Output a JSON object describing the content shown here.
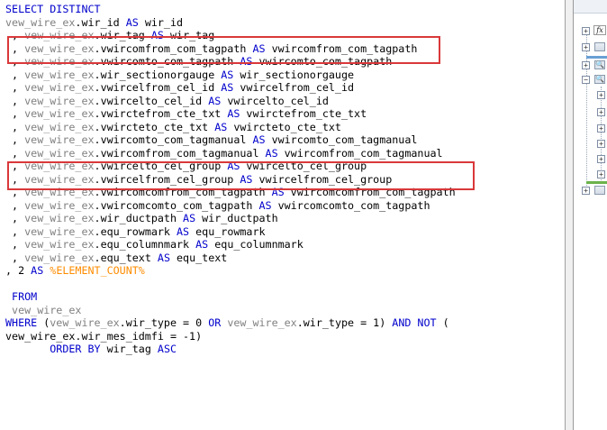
{
  "editor": {
    "highlight_color": "#d9383a",
    "lines": [
      [
        {
          "t": "SELECT DISTINCT",
          "c": "kw"
        }
      ],
      [
        {
          "t": "vew_wire_ex",
          "c": "tbl"
        },
        {
          "t": ".wir_id ",
          "c": "p"
        },
        {
          "t": "AS",
          "c": "kw"
        },
        {
          "t": " wir_id",
          "c": "p"
        }
      ],
      [
        {
          "t": " , ",
          "c": "p"
        },
        {
          "t": "vew_wire_ex",
          "c": "tbl"
        },
        {
          "t": ".wir_tag ",
          "c": "p"
        },
        {
          "t": "AS",
          "c": "kw"
        },
        {
          "t": " wir_tag",
          "c": "p"
        }
      ],
      [
        {
          "t": " , ",
          "c": "p"
        },
        {
          "t": "vew_wire_ex",
          "c": "tbl"
        },
        {
          "t": ".vwircomfrom_com_tagpath ",
          "c": "p"
        },
        {
          "t": "AS",
          "c": "kw"
        },
        {
          "t": " vwircomfrom_com_tagpath",
          "c": "p"
        }
      ],
      [
        {
          "t": " , ",
          "c": "p"
        },
        {
          "t": "vew_wire_ex",
          "c": "tbl"
        },
        {
          "t": ".vwircomto_com_tagpath ",
          "c": "p"
        },
        {
          "t": "AS",
          "c": "kw"
        },
        {
          "t": " vwircomto_com_tagpath",
          "c": "p"
        }
      ],
      [
        {
          "t": " , ",
          "c": "p"
        },
        {
          "t": "vew_wire_ex",
          "c": "tbl"
        },
        {
          "t": ".wir_sectionorgauge ",
          "c": "p"
        },
        {
          "t": "AS",
          "c": "kw"
        },
        {
          "t": " wir_sectionorgauge",
          "c": "p"
        }
      ],
      [
        {
          "t": " , ",
          "c": "p"
        },
        {
          "t": "vew_wire_ex",
          "c": "tbl"
        },
        {
          "t": ".vwircelfrom_cel_id ",
          "c": "p"
        },
        {
          "t": "AS",
          "c": "kw"
        },
        {
          "t": " vwircelfrom_cel_id",
          "c": "p"
        }
      ],
      [
        {
          "t": " , ",
          "c": "p"
        },
        {
          "t": "vew_wire_ex",
          "c": "tbl"
        },
        {
          "t": ".vwircelto_cel_id ",
          "c": "p"
        },
        {
          "t": "AS",
          "c": "kw"
        },
        {
          "t": " vwircelto_cel_id",
          "c": "p"
        }
      ],
      [
        {
          "t": " , ",
          "c": "p"
        },
        {
          "t": "vew_wire_ex",
          "c": "tbl"
        },
        {
          "t": ".vwirctefrom_cte_txt ",
          "c": "p"
        },
        {
          "t": "AS",
          "c": "kw"
        },
        {
          "t": " vwirctefrom_cte_txt",
          "c": "p"
        }
      ],
      [
        {
          "t": " , ",
          "c": "p"
        },
        {
          "t": "vew_wire_ex",
          "c": "tbl"
        },
        {
          "t": ".vwircteto_cte_txt ",
          "c": "p"
        },
        {
          "t": "AS",
          "c": "kw"
        },
        {
          "t": " vwircteto_cte_txt",
          "c": "p"
        }
      ],
      [
        {
          "t": " , ",
          "c": "p"
        },
        {
          "t": "vew_wire_ex",
          "c": "tbl"
        },
        {
          "t": ".vwircomto_com_tagmanual ",
          "c": "p"
        },
        {
          "t": "AS",
          "c": "kw"
        },
        {
          "t": " vwircomto_com_tagmanual",
          "c": "p"
        }
      ],
      [
        {
          "t": " , ",
          "c": "p"
        },
        {
          "t": "vew_wire_ex",
          "c": "tbl"
        },
        {
          "t": ".vwircomfrom_com_tagmanual ",
          "c": "p"
        },
        {
          "t": "AS",
          "c": "kw"
        },
        {
          "t": " vwircomfrom_com_tagmanual",
          "c": "p"
        }
      ],
      [
        {
          "t": " , ",
          "c": "p"
        },
        {
          "t": "vew_wire_ex",
          "c": "tbl"
        },
        {
          "t": ".vwircelto_cel_group ",
          "c": "p"
        },
        {
          "t": "AS",
          "c": "kw"
        },
        {
          "t": " vwircelto_cel_group",
          "c": "p"
        }
      ],
      [
        {
          "t": " , ",
          "c": "p"
        },
        {
          "t": "vew_wire_ex",
          "c": "tbl"
        },
        {
          "t": ".vwircelfrom_cel_group ",
          "c": "p"
        },
        {
          "t": "AS",
          "c": "kw"
        },
        {
          "t": " vwircelfrom_cel_group",
          "c": "p"
        }
      ],
      [
        {
          "t": " , ",
          "c": "p"
        },
        {
          "t": "vew_wire_ex",
          "c": "tbl"
        },
        {
          "t": ".vwircomcomfrom_com_tagpath ",
          "c": "p"
        },
        {
          "t": "AS",
          "c": "kw"
        },
        {
          "t": " vwircomcomfrom_com_tagpath",
          "c": "p"
        }
      ],
      [
        {
          "t": " , ",
          "c": "p"
        },
        {
          "t": "vew_wire_ex",
          "c": "tbl"
        },
        {
          "t": ".vwircomcomto_com_tagpath ",
          "c": "p"
        },
        {
          "t": "AS",
          "c": "kw"
        },
        {
          "t": " vwircomcomto_com_tagpath",
          "c": "p"
        }
      ],
      [
        {
          "t": " , ",
          "c": "p"
        },
        {
          "t": "vew_wire_ex",
          "c": "tbl"
        },
        {
          "t": ".wir_ductpath ",
          "c": "p"
        },
        {
          "t": "AS",
          "c": "kw"
        },
        {
          "t": " wir_ductpath",
          "c": "p"
        }
      ],
      [
        {
          "t": " , ",
          "c": "p"
        },
        {
          "t": "vew_wire_ex",
          "c": "tbl"
        },
        {
          "t": ".equ_rowmark ",
          "c": "p"
        },
        {
          "t": "AS",
          "c": "kw"
        },
        {
          "t": " equ_rowmark",
          "c": "p"
        }
      ],
      [
        {
          "t": " , ",
          "c": "p"
        },
        {
          "t": "vew_wire_ex",
          "c": "tbl"
        },
        {
          "t": ".equ_columnmark ",
          "c": "p"
        },
        {
          "t": "AS",
          "c": "kw"
        },
        {
          "t": " equ_columnmark",
          "c": "p"
        }
      ],
      [
        {
          "t": " , ",
          "c": "p"
        },
        {
          "t": "vew_wire_ex",
          "c": "tbl"
        },
        {
          "t": ".equ_text ",
          "c": "p"
        },
        {
          "t": "AS",
          "c": "kw"
        },
        {
          "t": " equ_text",
          "c": "p"
        }
      ],
      [
        {
          "t": ", 2 ",
          "c": "p"
        },
        {
          "t": "AS",
          "c": "kw"
        },
        {
          "t": " ",
          "c": "p"
        },
        {
          "t": "%ELEMENT_COUNT%",
          "c": "sym"
        }
      ],
      [
        {
          "t": "",
          "c": "p"
        }
      ],
      [
        {
          "t": " FROM",
          "c": "kw"
        }
      ],
      [
        {
          "t": " ",
          "c": "p"
        },
        {
          "t": "vew_wire_ex",
          "c": "tbl"
        }
      ],
      [
        {
          "t": "WHERE",
          "c": "kw"
        },
        {
          "t": " (",
          "c": "p"
        },
        {
          "t": "vew_wire_ex",
          "c": "tbl"
        },
        {
          "t": ".wir_type = 0 ",
          "c": "p"
        },
        {
          "t": "OR",
          "c": "kw"
        },
        {
          "t": " ",
          "c": "p"
        },
        {
          "t": "vew_wire_ex",
          "c": "tbl"
        },
        {
          "t": ".wir_type = 1) ",
          "c": "p"
        },
        {
          "t": "AND NOT",
          "c": "kw"
        },
        {
          "t": " (",
          "c": "p"
        }
      ],
      [
        {
          "t": "vew_wire_ex.wir_mes_idmfi = -1)",
          "c": "p"
        }
      ],
      [
        {
          "t": "       ",
          "c": "p"
        },
        {
          "t": "ORDER BY",
          "c": "kw"
        },
        {
          "t": " wir_tag ",
          "c": "p"
        },
        {
          "t": "ASC",
          "c": "kw"
        }
      ]
    ]
  },
  "panel": {
    "fx_label": "fx",
    "expand_glyph": "+",
    "collapse_glyph": "−",
    "magnifier_glyph": "🔍",
    "accent_green": "#6bb34a",
    "accent_blue": "#6a9fd4"
  }
}
